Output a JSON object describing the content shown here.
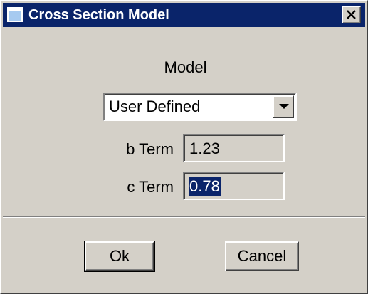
{
  "window": {
    "title": "Cross Section Model",
    "title_icon": "window-icon",
    "close_icon": "close-icon"
  },
  "model": {
    "label": "Model",
    "selected": "User Defined",
    "dropdown_icon": "chevron-down-icon"
  },
  "b_term": {
    "label": "b Term",
    "value": "1.23"
  },
  "c_term": {
    "label": "c Term",
    "value": "0.78",
    "selected": true
  },
  "buttons": {
    "ok": "Ok",
    "cancel": "Cancel"
  },
  "colors": {
    "titlebar": "#0a246a",
    "face": "#d4d0c8",
    "selection": "#0a246a"
  }
}
